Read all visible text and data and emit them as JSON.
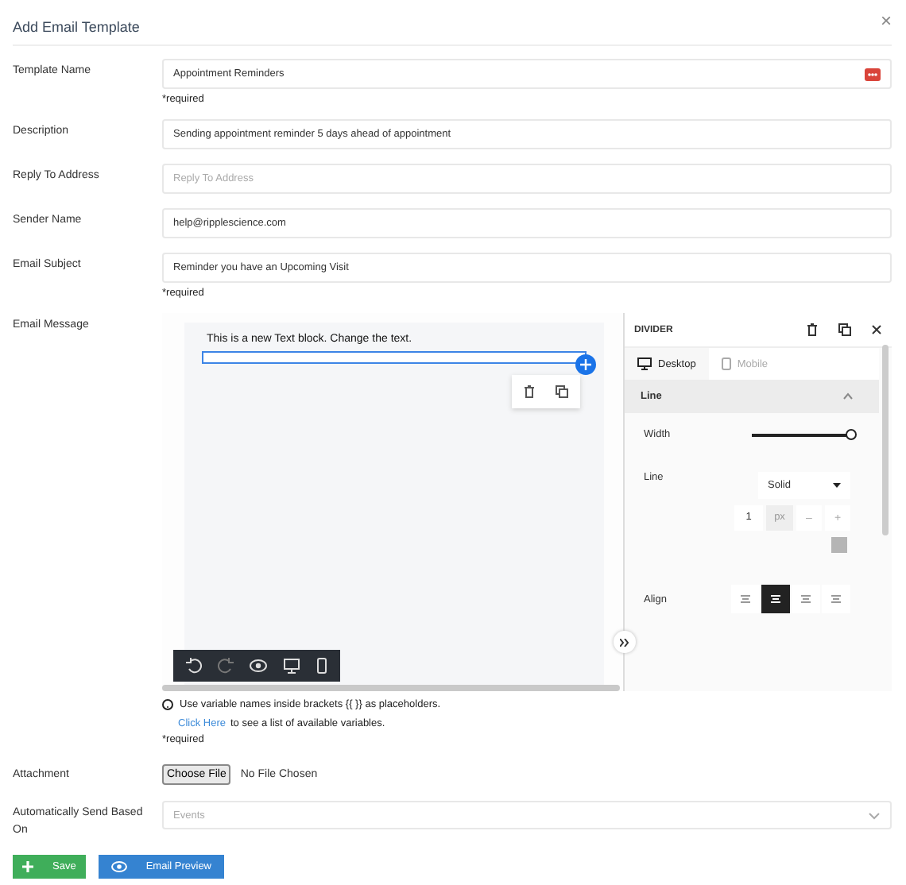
{
  "dialog": {
    "title": "Add Email Template",
    "close": "×"
  },
  "fields": [
    {
      "label": "Template Name",
      "value": "Appointment Reminders",
      "required_note": "*required",
      "has_menu": true
    },
    {
      "label": "Description",
      "value": "Sending appointment reminder 5 days ahead of appointment",
      "has_menu": false
    },
    {
      "label": "Reply To Address",
      "placeholder": "Reply To Address",
      "has_menu": false
    },
    {
      "label": "Sender Name",
      "value": "help@ripplescience.com",
      "has_menu": false
    },
    {
      "label": "Email Subject",
      "value": "Reminder you have an Upcoming Visit",
      "required_note": "*required",
      "has_menu": false
    }
  ],
  "email_message": {
    "label": "Email Message",
    "canvas_text": "This is a new Text block. Change the text.",
    "panel": {
      "title": "DIVIDER",
      "tabs": [
        {
          "label": "Desktop",
          "selected": true
        },
        {
          "label": "Mobile",
          "selected": false
        }
      ],
      "section": {
        "title": "Line",
        "expanded": true
      },
      "width": {
        "label": "Width",
        "level": 1.0
      },
      "line_label": "Line",
      "line_style": "Solid",
      "line_value": "1",
      "unit": "px",
      "minus": "–",
      "plus": "+",
      "align_label": "Align",
      "align": [
        {
          "selected": false
        },
        {
          "selected": true
        },
        {
          "selected": false
        },
        {
          "selected": false
        }
      ]
    },
    "help": "Use variable names inside brackets {{ }} as placeholders.",
    "link": "Click Here",
    "link_rest": "to see a list of available variables.",
    "required_note": "*required"
  },
  "attachment": {
    "label": "Attachment",
    "button": "Choose File",
    "status": "No File Chosen"
  },
  "auto_send": {
    "label": "Automatically Send Based On",
    "placeholder": "Events"
  },
  "buttons": [
    {
      "label": "Save",
      "kind": "save"
    },
    {
      "label": "Email Preview",
      "kind": "preview"
    }
  ]
}
